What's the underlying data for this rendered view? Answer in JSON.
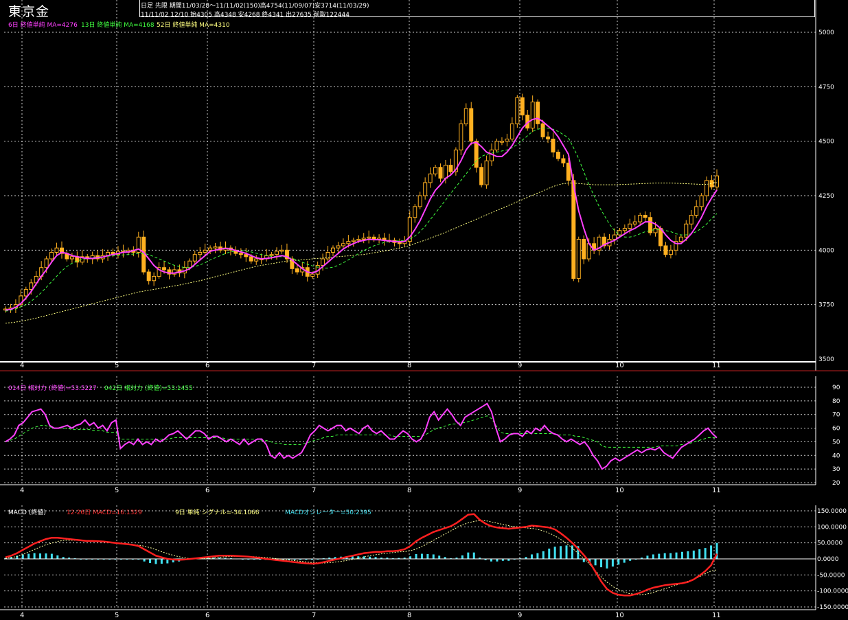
{
  "header": {
    "title": "東京金",
    "line1": "日足  先限  期間11/03/28〜11/11/02(150)高4754(11/09/07)安3714(11/03/29)",
    "line2": "11/11/02  12/10  始4305  高4348  安4268  終4341  出27635  前取122444"
  },
  "price_legend": {
    "ma6": "6日  終値単純  MA=4276",
    "ma13": "13日  終値単純  MA=4168",
    "ma52": "52日  終値単純  MA=4310"
  },
  "rsi_legend": {
    "r14": "014日  相対力  (終値)=53.5227",
    "r42": "042日  相対力  (終値)=53.1455"
  },
  "macd_legend": {
    "label": "MACD (終値)",
    "macd": "12-26日  MACD=16.1329",
    "signal": "9日  単純  シグナル=-34.1066",
    "osc": "MACDオシレーター=50.2395"
  },
  "colors": {
    "candle": "#ffb020",
    "ma6": "#ff40ff",
    "ma13": "#40ff40",
    "ma52": "#ffff80",
    "rsi14": "#ff40ff",
    "rsi42": "#40ff40",
    "macd": "#ff2020",
    "signal": "#ffffa0",
    "osc": "#40e0f0",
    "grid": "#ffffff"
  },
  "chart_data": [
    {
      "type": "candlestick",
      "title": "東京金",
      "x_tick_labels": [
        "4",
        "5",
        "6",
        "7",
        "8",
        "9",
        "10",
        "11"
      ],
      "y_tick_labels": [
        "5000",
        "4750",
        "4500",
        "4250",
        "4000",
        "3750",
        "3500"
      ],
      "ylim": [
        3500,
        5000
      ],
      "close": [
        3730,
        3735,
        3750,
        3790,
        3820,
        3850,
        3880,
        3920,
        3960,
        3990,
        4010,
        3985,
        3960,
        3970,
        3945,
        3970,
        3960,
        3975,
        3960,
        3975,
        3990,
        3980,
        3995,
        3990,
        4000,
        3990,
        4060,
        3900,
        3860,
        3880,
        3920,
        3910,
        3890,
        3910,
        3895,
        3920,
        3950,
        3980,
        3990,
        4000,
        4010,
        4015,
        4000,
        4010,
        4000,
        3985,
        3980,
        3970,
        3950,
        3960,
        3960,
        3975,
        3980,
        3995,
        4000,
        3960,
        3915,
        3900,
        3920,
        3880,
        3890,
        3930,
        3960,
        3990,
        4010,
        4020,
        4030,
        4040,
        4045,
        4050,
        4055,
        4060,
        4050,
        4055,
        4045,
        4045,
        4035,
        4030,
        4040,
        4150,
        4200,
        4250,
        4310,
        4350,
        4380,
        4330,
        4390,
        4360,
        4460,
        4580,
        4650,
        4500,
        4380,
        4300,
        4410,
        4460,
        4500,
        4500,
        4510,
        4580,
        4700,
        4620,
        4560,
        4680,
        4580,
        4520,
        4510,
        4450,
        4420,
        4400,
        4320,
        3870,
        4050,
        3960,
        4030,
        4000,
        4060,
        4020,
        4050,
        4070,
        4090,
        4100,
        4120,
        4130,
        4160,
        4150,
        4080,
        4100,
        4020,
        3980,
        4000,
        4040,
        4060,
        4120,
        4160,
        4200,
        4250,
        4320,
        4290,
        4341
      ],
      "ma6": [
        3725,
        3728,
        3738,
        3755,
        3780,
        3810,
        3845,
        3880,
        3910,
        3945,
        3975,
        3990,
        3985,
        3975,
        3970,
        3965,
        3962,
        3962,
        3965,
        3968,
        3975,
        3980,
        3985,
        3990,
        3992,
        3998,
        4005,
        3990,
        3960,
        3930,
        3910,
        3900,
        3895,
        3895,
        3900,
        3905,
        3915,
        3935,
        3955,
        3975,
        3995,
        4000,
        4005,
        4008,
        4005,
        3998,
        3992,
        3985,
        3975,
        3965,
        3960,
        3962,
        3965,
        3970,
        3975,
        3970,
        3955,
        3935,
        3915,
        3900,
        3895,
        3905,
        3925,
        3945,
        3965,
        3985,
        4005,
        4020,
        4030,
        4040,
        4045,
        4050,
        4048,
        4048,
        4045,
        4042,
        4040,
        4038,
        4040,
        4060,
        4095,
        4135,
        4185,
        4235,
        4275,
        4300,
        4330,
        4345,
        4370,
        4410,
        4460,
        4490,
        4495,
        4475,
        4450,
        4440,
        4430,
        4430,
        4450,
        4480,
        4520,
        4560,
        4585,
        4600,
        4605,
        4590,
        4570,
        4550,
        4520,
        4480,
        4440,
        4300,
        4180,
        4100,
        4030,
        4000,
        4010,
        4025,
        4035,
        4045,
        4060,
        4075,
        4090,
        4100,
        4115,
        4130,
        4130,
        4120,
        4100,
        4070,
        4045,
        4030,
        4030,
        4050,
        4075,
        4110,
        4150,
        4200,
        4240,
        4276
      ],
      "ma13": [
        3720,
        3724,
        3730,
        3740,
        3750,
        3765,
        3785,
        3805,
        3830,
        3855,
        3880,
        3905,
        3925,
        3940,
        3950,
        3958,
        3962,
        3965,
        3968,
        3970,
        3972,
        3974,
        3976,
        3978,
        3980,
        3982,
        3985,
        3984,
        3980,
        3970,
        3960,
        3950,
        3940,
        3930,
        3925,
        3920,
        3920,
        3925,
        3932,
        3942,
        3955,
        3965,
        3975,
        3985,
        3992,
        3996,
        3998,
        3996,
        3992,
        3986,
        3980,
        3975,
        3972,
        3970,
        3970,
        3968,
        3962,
        3955,
        3945,
        3935,
        3928,
        3922,
        3918,
        3918,
        3922,
        3930,
        3942,
        3955,
        3970,
        3985,
        3998,
        4010,
        4020,
        4028,
        4035,
        4040,
        4042,
        4043,
        4044,
        4050,
        4065,
        4085,
        4110,
        4140,
        4170,
        4200,
        4230,
        4260,
        4290,
        4320,
        4350,
        4380,
        4410,
        4430,
        4440,
        4445,
        4450,
        4455,
        4460,
        4470,
        4485,
        4505,
        4525,
        4545,
        4555,
        4560,
        4560,
        4555,
        4545,
        4530,
        4515,
        4470,
        4420,
        4360,
        4300,
        4250,
        4200,
        4160,
        4120,
        4090,
        4070,
        4060,
        4060,
        4065,
        4075,
        4085,
        4090,
        4095,
        4095,
        4090,
        4085,
        4075,
        4070,
        4070,
        4075,
        4085,
        4100,
        4120,
        4145,
        4168
      ],
      "ma52": [
        3665,
        3667,
        3670,
        3674,
        3678,
        3683,
        3688,
        3694,
        3700,
        3706,
        3712,
        3718,
        3724,
        3730,
        3736,
        3742,
        3748,
        3754,
        3760,
        3766,
        3772,
        3778,
        3784,
        3790,
        3796,
        3802,
        3808,
        3812,
        3816,
        3820,
        3824,
        3828,
        3832,
        3836,
        3840,
        3845,
        3850,
        3855,
        3860,
        3866,
        3872,
        3878,
        3884,
        3890,
        3896,
        3902,
        3908,
        3914,
        3920,
        3926,
        3930,
        3934,
        3938,
        3942,
        3946,
        3950,
        3952,
        3954,
        3956,
        3958,
        3960,
        3962,
        3964,
        3966,
        3968,
        3970,
        3972,
        3974,
        3976,
        3978,
        3980,
        3984,
        3988,
        3992,
        3996,
        4000,
        4005,
        4010,
        4015,
        4022,
        4030,
        4038,
        4046,
        4055,
        4064,
        4073,
        4082,
        4092,
        4102,
        4112,
        4122,
        4132,
        4142,
        4152,
        4162,
        4172,
        4182,
        4192,
        4202,
        4212,
        4222,
        4232,
        4242,
        4252,
        4262,
        4272,
        4282,
        4292,
        4300,
        4305,
        4308,
        4308,
        4306,
        4304,
        4302,
        4300,
        4300,
        4300,
        4300,
        4300,
        4301,
        4302,
        4303,
        4304,
        4305,
        4306,
        4307,
        4308,
        4308,
        4308,
        4308,
        4307,
        4306,
        4305,
        4304,
        4303,
        4302,
        4302,
        4306,
        4310
      ]
    },
    {
      "type": "line",
      "title": "相対力",
      "y_tick_labels": [
        "90",
        "80",
        "70",
        "60",
        "50",
        "40",
        "30",
        "20"
      ],
      "ylim": [
        20,
        90
      ],
      "rsi14": [
        50,
        52,
        55,
        62,
        64,
        68,
        72,
        73,
        74,
        70,
        62,
        60,
        60,
        61,
        62,
        60,
        62,
        63,
        66,
        62,
        64,
        60,
        62,
        58,
        64,
        66,
        45,
        48,
        50,
        48,
        52,
        48,
        50,
        48,
        52,
        50,
        52,
        55,
        56,
        58,
        55,
        52,
        55,
        58,
        58,
        56,
        52,
        54,
        54,
        52,
        50,
        52,
        50,
        48,
        52,
        48,
        50,
        52,
        52,
        48,
        40,
        38,
        42,
        38,
        40,
        38,
        40,
        42,
        48,
        55,
        58,
        62,
        60,
        58,
        60,
        62,
        62,
        58,
        60,
        58,
        56,
        60,
        62,
        58,
        56,
        58,
        55,
        52,
        52,
        55,
        58,
        56,
        52,
        50,
        52,
        58,
        68,
        72,
        66,
        70,
        74,
        70,
        65,
        62,
        68,
        70,
        72,
        74,
        76,
        78,
        72,
        60,
        50,
        52,
        55,
        56,
        56,
        54,
        58,
        56,
        60,
        58,
        62,
        58,
        56,
        55,
        52,
        50,
        52,
        50,
        48,
        50,
        46,
        40,
        36,
        30,
        32,
        36,
        38,
        36,
        38,
        40,
        42,
        44,
        42,
        44,
        45,
        44,
        46,
        42,
        40,
        38,
        42,
        46,
        48,
        50,
        52,
        55,
        58,
        60,
        56,
        53
      ],
      "rsi42": [
        50,
        51,
        52,
        54,
        56,
        58,
        60,
        61,
        62,
        62,
        61,
        60,
        60,
        60,
        60,
        59,
        59,
        59,
        59,
        59,
        58,
        58,
        58,
        57,
        57,
        57,
        52,
        52,
        52,
        52,
        52,
        52,
        52,
        52,
        52,
        52,
        52,
        52,
        53,
        53,
        53,
        53,
        53,
        53,
        53,
        53,
        53,
        53,
        53,
        53,
        52,
        52,
        52,
        52,
        52,
        52,
        52,
        52,
        51,
        51,
        50,
        49,
        49,
        48,
        48,
        48,
        48,
        48,
        49,
        50,
        51,
        52,
        53,
        54,
        54,
        55,
        55,
        55,
        55,
        55,
        55,
        55,
        55,
        55,
        55,
        55,
        55,
        55,
        54,
        54,
        54,
        54,
        54,
        54,
        54,
        55,
        57,
        59,
        60,
        61,
        62,
        63,
        63,
        64,
        64,
        65,
        66,
        67,
        68,
        69,
        67,
        62,
        57,
        56,
        56,
        56,
        56,
        56,
        56,
        56,
        56,
        56,
        56,
        56,
        56,
        55,
        55,
        55,
        55,
        54,
        54,
        53,
        52,
        51,
        50,
        47,
        46,
        46,
        46,
        46,
        46,
        46,
        46,
        46,
        46,
        46,
        46,
        46,
        47,
        47,
        47,
        47,
        47,
        48,
        48,
        49,
        50,
        51,
        52,
        53,
        53,
        53
      ]
    },
    {
      "type": "line",
      "title": "MACD",
      "y_tick_labels": [
        "150.0000",
        "100.0000",
        "50.0000",
        "0.0000",
        "-50.0000",
        "-100.0000",
        "-150.0000"
      ],
      "ylim": [
        -150,
        150
      ],
      "macd": [
        5,
        10,
        18,
        28,
        38,
        48,
        55,
        62,
        66,
        66,
        64,
        62,
        60,
        58,
        56,
        56,
        55,
        54,
        52,
        50,
        48,
        46,
        44,
        40,
        30,
        20,
        10,
        5,
        0,
        -2,
        -3,
        -2,
        0,
        2,
        4,
        6,
        8,
        10,
        10,
        10,
        9,
        8,
        7,
        5,
        3,
        0,
        -2,
        -4,
        -6,
        -8,
        -10,
        -12,
        -14,
        -15,
        -14,
        -10,
        -6,
        -2,
        2,
        6,
        10,
        14,
        18,
        20,
        22,
        22,
        24,
        24,
        26,
        30,
        40,
        55,
        66,
        75,
        84,
        90,
        96,
        102,
        112,
        125,
        138,
        140,
        122,
        110,
        102,
        98,
        96,
        94,
        96,
        98,
        100,
        104,
        102,
        100,
        98,
        92,
        80,
        66,
        50,
        32,
        12,
        -10,
        -40,
        -70,
        -94,
        -106,
        -112,
        -114,
        -114,
        -110,
        -104,
        -96,
        -90,
        -86,
        -82,
        -80,
        -78,
        -76,
        -72,
        -64,
        -52,
        -38,
        -20,
        16
      ],
      "signal": [
        2,
        4,
        8,
        14,
        22,
        30,
        38,
        45,
        50,
        55,
        58,
        58,
        58,
        58,
        57,
        56,
        55,
        54,
        52,
        50,
        48,
        46,
        44,
        42,
        38,
        33,
        26,
        20,
        14,
        9,
        5,
        2,
        0,
        0,
        1,
        2,
        4,
        6,
        7,
        8,
        8,
        8,
        7,
        6,
        5,
        3,
        1,
        -1,
        -3,
        -5,
        -7,
        -9,
        -11,
        -12,
        -13,
        -12,
        -10,
        -8,
        -5,
        -2,
        2,
        6,
        10,
        13,
        16,
        18,
        20,
        22,
        23,
        26,
        32,
        40,
        50,
        60,
        70,
        80,
        90,
        100,
        108,
        114,
        118,
        120,
        118,
        114,
        110,
        106,
        102,
        100,
        98,
        96,
        94,
        90,
        84,
        76,
        66,
        54,
        40,
        24,
        8,
        -10,
        -30,
        -50,
        -68,
        -82,
        -94,
        -102,
        -108,
        -110,
        -112,
        -110,
        -106,
        -100,
        -94,
        -88,
        -82,
        -76,
        -70,
        -64,
        -56,
        -46,
        -38,
        -34
      ],
      "oscillator": [
        3,
        6,
        10,
        14,
        16,
        18,
        17,
        17,
        16,
        11,
        6,
        4,
        2,
        0,
        -1,
        0,
        0,
        0,
        0,
        0,
        0,
        0,
        0,
        -2,
        -8,
        -13,
        -16,
        -15,
        -14,
        -11,
        -8,
        -4,
        0,
        2,
        3,
        4,
        4,
        4,
        3,
        2,
        1,
        0,
        0,
        -1,
        -2,
        -3,
        -3,
        -3,
        -3,
        -3,
        -3,
        -3,
        -3,
        -3,
        -1,
        2,
        4,
        6,
        7,
        8,
        8,
        8,
        8,
        7,
        6,
        4,
        4,
        2,
        3,
        4,
        8,
        15,
        16,
        15,
        14,
        10,
        6,
        2,
        4,
        11,
        20,
        20,
        4,
        -4,
        -8,
        -8,
        -6,
        -6,
        -2,
        2,
        6,
        14,
        18,
        24,
        32,
        38,
        40,
        42,
        42,
        40,
        -10,
        -12,
        -20,
        -26,
        -30,
        -24,
        -18,
        -12,
        -6,
        -2,
        4,
        10,
        14,
        16,
        18,
        18,
        20,
        22,
        24,
        26,
        30,
        34,
        42,
        50
      ]
    }
  ]
}
